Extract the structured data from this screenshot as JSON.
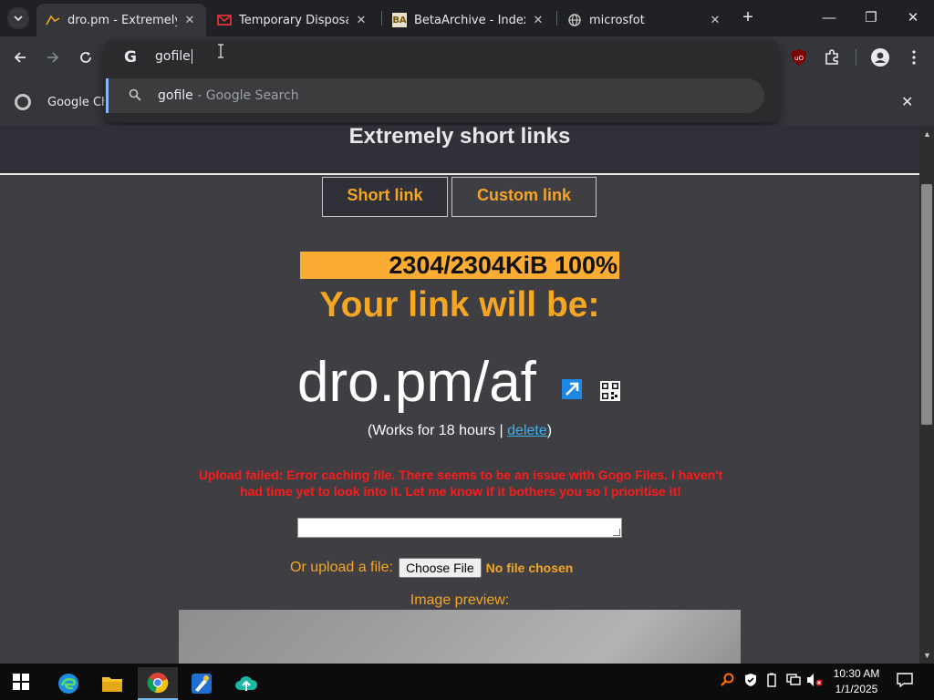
{
  "browser": {
    "tabs": [
      {
        "title": "dro.pm - Extremely Sh",
        "active": true
      },
      {
        "title": "Temporary Disposable",
        "active": false
      },
      {
        "title": "BetaArchive - Index pa",
        "active": false
      },
      {
        "title": "microsfot",
        "active": false
      }
    ],
    "tab_close_glyph": "✕",
    "newtab_glyph": "+",
    "window": {
      "minimize": "—",
      "maximize": "❐",
      "close": "✕"
    },
    "favicon_ba": "BA",
    "omnibox": {
      "g_logo": "G",
      "input_value": "gofile",
      "suggestion_query": "gofile",
      "suggestion_suffix": " - Google Search"
    },
    "infobar": {
      "text": "Google Ch",
      "close": "✕"
    },
    "ublock_badge": "uO"
  },
  "page": {
    "header_title": "Extremely short links",
    "tab_short": "Short link",
    "tab_custom": "Custom link",
    "progress": {
      "text": "2304/2304KiB 100%",
      "percent": 100
    },
    "link_will_be": "Your link will be:",
    "short_link": "dro.pm/af",
    "works_prefix": "(Works for 18 hours | ",
    "delete_label": "delete",
    "works_suffix": ")",
    "error_text": "Upload failed: Error caching file. There seems to be an issue with Gogo Files. I haven't had time yet to look into it. Let me know if it bothers you so I prioritise it!",
    "upload_label": "Or upload a file:",
    "choose_file": "Choose File",
    "no_file": "No file chosen",
    "preview_label": "Image preview:"
  },
  "taskbar": {
    "time": "10:30 AM",
    "date": "1/1/2025"
  },
  "colors": {
    "accent_orange": "#f5a623",
    "progress_bar": "#fbac32",
    "error_red": "#ff1a1a",
    "link_blue": "#3fb0e8",
    "page_bg": "#3e3e43"
  }
}
